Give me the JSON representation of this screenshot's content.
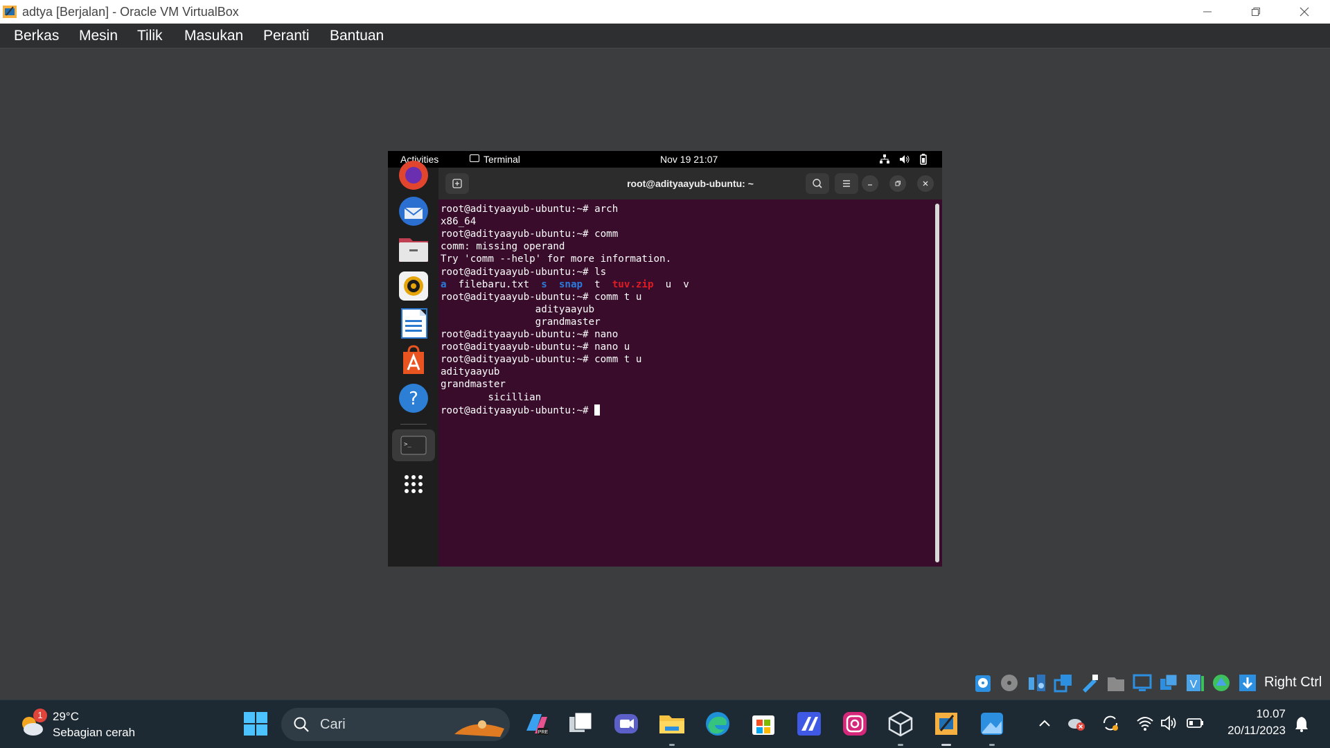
{
  "window": {
    "title": "adtya [Berjalan] - Oracle VM VirtualBox",
    "menu": [
      "Berkas",
      "Mesin",
      "Tilik",
      "Masukan",
      "Peranti",
      "Bantuan"
    ]
  },
  "gnome": {
    "activities": "Activities",
    "app_label": "Terminal",
    "clock": "Nov 19  21:07"
  },
  "terminal": {
    "title": "root@adityaayub-ubuntu: ~",
    "lines": [
      {
        "text": "root@adityaayub-ubuntu:~# arch",
        "color": "#ffffff"
      },
      {
        "text": "x86_64",
        "color": "#ffffff"
      },
      {
        "text": "root@adityaayub-ubuntu:~# comm",
        "color": "#ffffff"
      },
      {
        "text": "comm: missing operand",
        "color": "#ffffff"
      },
      {
        "text": "Try 'comm --help' for more information.",
        "color": "#ffffff"
      },
      {
        "text": "root@adityaayub-ubuntu:~# ls",
        "color": "#ffffff"
      },
      {
        "text": "",
        "color": "#ffffff"
      },
      {
        "text": "root@adityaayub-ubuntu:~# comm t u",
        "color": "#ffffff"
      },
      {
        "text": "                adityaayub",
        "color": "#ffffff"
      },
      {
        "text": "                grandmaster",
        "color": "#ffffff"
      },
      {
        "text": "root@adityaayub-ubuntu:~# nano",
        "color": "#ffffff"
      },
      {
        "text": "root@adityaayub-ubuntu:~# nano u",
        "color": "#ffffff"
      },
      {
        "text": "root@adityaayub-ubuntu:~# comm t u",
        "color": "#ffffff"
      },
      {
        "text": "adityaayub",
        "color": "#ffffff"
      },
      {
        "text": "grandmaster",
        "color": "#ffffff"
      },
      {
        "text": "        sicillian",
        "color": "#ffffff"
      },
      {
        "text": "root@adityaayub-ubuntu:~# ",
        "color": "#ffffff"
      }
    ],
    "ls_output": [
      {
        "text": "a",
        "color": "#2a7bde"
      },
      {
        "text": "  filebaru.txt  ",
        "color": "#ffffff"
      },
      {
        "text": "s",
        "color": "#2a7bde"
      },
      {
        "text": "  ",
        "color": "#ffffff"
      },
      {
        "text": "snap",
        "color": "#2a7bde"
      },
      {
        "text": "  t  ",
        "color": "#ffffff"
      },
      {
        "text": "tuv.zip",
        "color": "#e01b24"
      },
      {
        "text": "  u  v",
        "color": "#ffffff"
      }
    ]
  },
  "host_tray": {
    "hostkey": "Right Ctrl"
  },
  "weather": {
    "temp": "29°C",
    "desc": "Sebagian cerah",
    "badge": "1"
  },
  "search": {
    "placeholder": "Cari"
  },
  "clock": {
    "time": "10.07",
    "date": "20/11/2023"
  },
  "colors": {
    "terminal_bg": "#380c2a",
    "taskbar_bg": "#1d2a33",
    "host_bg": "#3c3d3f"
  }
}
